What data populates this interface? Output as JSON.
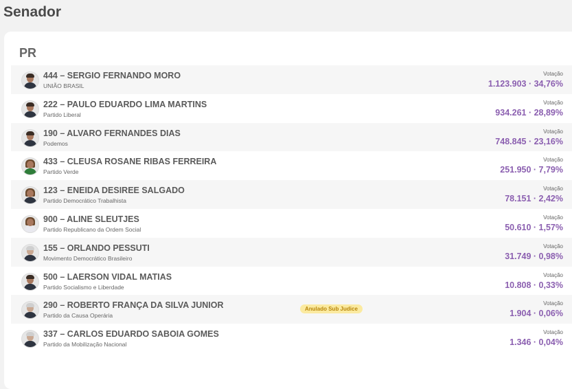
{
  "page": {
    "title": "Senador"
  },
  "state": "PR",
  "votes_label": "Votação",
  "accent_color": "#8b5fb0",
  "badge_color": "#fbeaa0",
  "candidates": [
    {
      "name": "444 – SERGIO FERNANDO MORO",
      "party": "UNIÃO BRASIL",
      "votes": "1.123.903 · 34,76%",
      "badge": ""
    },
    {
      "name": "222 – PAULO EDUARDO LIMA MARTINS",
      "party": "Partido Liberal",
      "votes": "934.261 · 28,89%",
      "badge": ""
    },
    {
      "name": "190 – ALVARO FERNANDES DIAS",
      "party": "Podemos",
      "votes": "748.845 · 23,16%",
      "badge": ""
    },
    {
      "name": "433 – CLEUSA ROSANE RIBAS FERREIRA",
      "party": "Partido Verde",
      "votes": "251.950 · 7,79%",
      "badge": ""
    },
    {
      "name": "123 – ENEIDA DESIREE SALGADO",
      "party": "Partido Democrático Trabalhista",
      "votes": "78.151 · 2,42%",
      "badge": ""
    },
    {
      "name": "900 – ALINE SLEUTJES",
      "party": "Partido Republicano da Ordem Social",
      "votes": "50.610 · 1,57%",
      "badge": ""
    },
    {
      "name": "155 – ORLANDO PESSUTI",
      "party": "Movimento Democrático Brasileiro",
      "votes": "31.749 · 0,98%",
      "badge": ""
    },
    {
      "name": "500 – LAERSON VIDAL MATIAS",
      "party": "Partido Socialismo e Liberdade",
      "votes": "10.808 · 0,33%",
      "badge": ""
    },
    {
      "name": "290 – ROBERTO FRANÇA DA SILVA JUNIOR",
      "party": "Partido da Causa Operária",
      "votes": "1.904 · 0,06%",
      "badge": "Anulado Sub Judice"
    },
    {
      "name": "337 – CARLOS EDUARDO SABOIA GOMES",
      "party": "Partido da Mobilização Nacional",
      "votes": "1.346 · 0,04%",
      "badge": ""
    }
  ]
}
